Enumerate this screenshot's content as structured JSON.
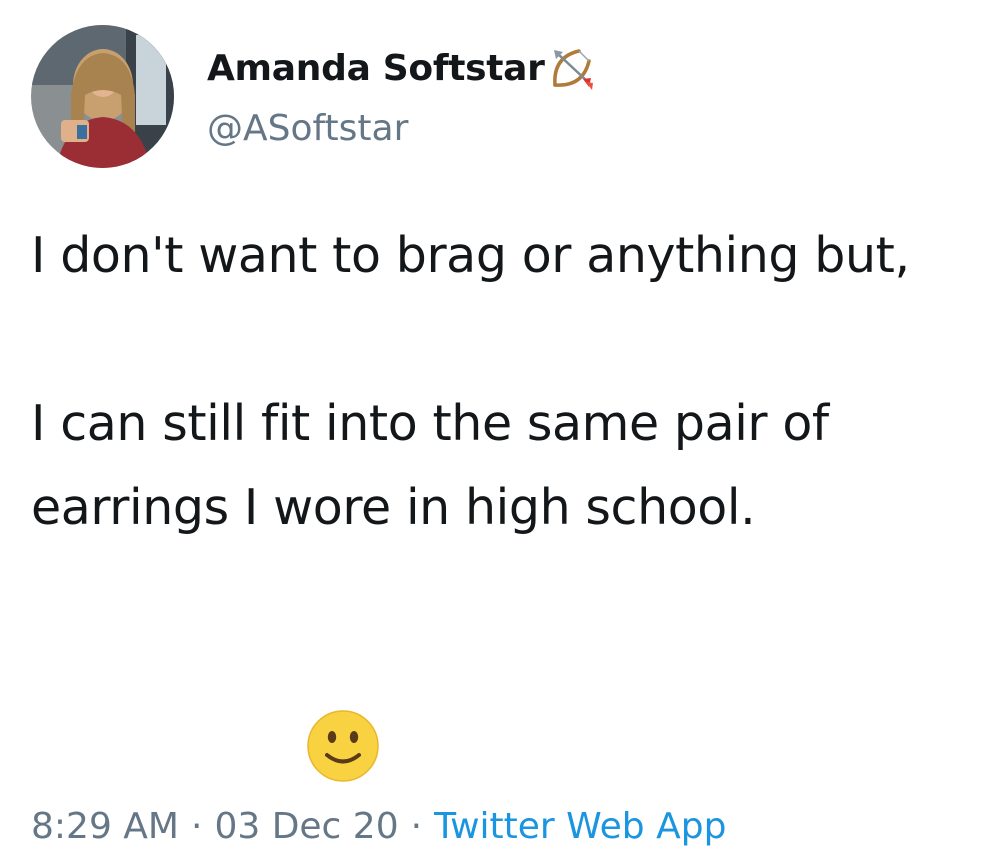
{
  "author": {
    "display_name": "Amanda Softstar",
    "handle": "@ASoftstar",
    "name_emoji": "bow-and-arrow-icon",
    "avatar": "profile-photo"
  },
  "tweet": {
    "text": "I don't want to brag or anything but,\n\nI can still fit into the same pair of earrings I wore in high school.",
    "emoji": "slightly-smiling-face-icon"
  },
  "meta": {
    "time": "8:29 AM",
    "separator": "·",
    "date": "03 Dec 20",
    "source": "Twitter Web App"
  },
  "colors": {
    "text": "#14171a",
    "secondary": "#657786",
    "link": "#1b95e0"
  }
}
